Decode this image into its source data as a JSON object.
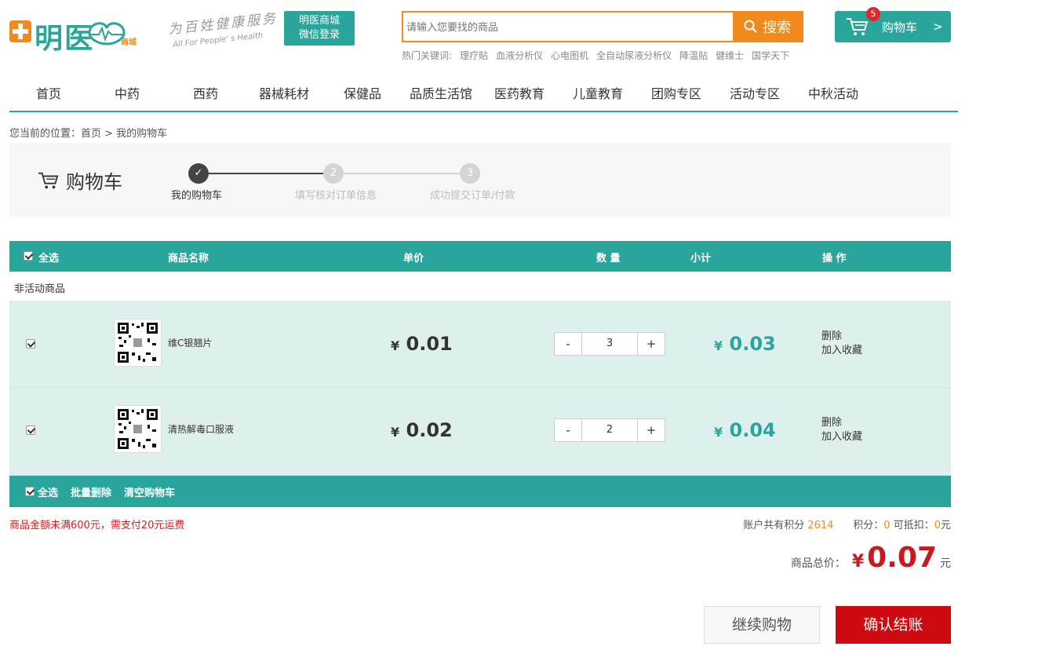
{
  "header": {
    "logo_text": "明医",
    "logo_sub": "商城",
    "slogan_cn": "为百姓健康服务",
    "slogan_en": "All For People' s Health",
    "wechat_login_line1": "明医商城",
    "wechat_login_line2": "微信登录",
    "search_placeholder": "请输入您要找的商品",
    "search_button": "搜索",
    "hot_label": "热门关键词:",
    "hot_keywords": [
      "理疗贴",
      "血液分析仪",
      "心电图机",
      "全自动尿液分析仪",
      "降温贴",
      "健维士",
      "国学天下"
    ],
    "cart_label": "购物车",
    "cart_arrow": ">",
    "cart_count": "5"
  },
  "nav": [
    "首页",
    "中药",
    "西药",
    "器械耗材",
    "保健品",
    "品质生活馆",
    "医药教育",
    "儿童教育",
    "团购专区",
    "活动专区",
    "中秋活动"
  ],
  "breadcrumb": "您当前的位置：首页 > 我的购物车",
  "steps": {
    "title": "购物车",
    "items": [
      {
        "num": "✓",
        "label": "我的购物车"
      },
      {
        "num": "2",
        "label": "填写核对订单信息"
      },
      {
        "num": "3",
        "label": "成功提交订单/付款"
      }
    ]
  },
  "table": {
    "select_all": "全选",
    "col_name": "商品名称",
    "col_price": "单价",
    "col_qty": "数 量",
    "col_subtotal": "小计",
    "col_ops": "操 作",
    "group_label": "非活动商品",
    "rows": [
      {
        "name": "维C银翘片",
        "yen": "¥",
        "price": "0.01",
        "qty": "3",
        "subtotal": "0.03",
        "delete": "删除",
        "favorite": "加入收藏"
      },
      {
        "name": "清热解毒口服液",
        "yen": "¥",
        "price": "0.02",
        "qty": "2",
        "subtotal": "0.04",
        "delete": "删除",
        "favorite": "加入收藏"
      }
    ],
    "minus": "-",
    "plus": "+"
  },
  "footer": {
    "select_all": "全选",
    "batch_delete": "批量删除",
    "clear_cart": "清空购物车"
  },
  "summary": {
    "notice": "商品金额未满600元，需支付20元运费",
    "points_label": "账户共有积分",
    "points_total": "2614",
    "points_use_label": "积分：",
    "points_use": "0",
    "deduct_label": "可抵扣：",
    "deduct_value": "0",
    "yuan": "元",
    "total_label": "商品总价：",
    "yen": "¥",
    "total_amount": "0.07"
  },
  "actions": {
    "continue": "继续购物",
    "confirm": "确认结账"
  },
  "colors": {
    "teal": "#2aa59c",
    "orange": "#f08a1c",
    "red": "#cc0a0f"
  }
}
